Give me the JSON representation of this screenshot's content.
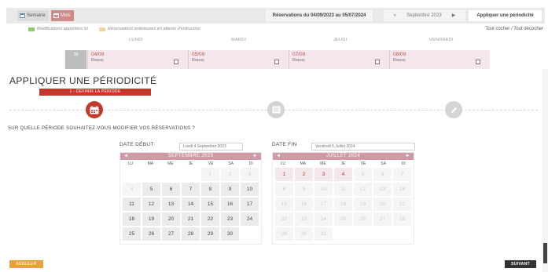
{
  "topbar": {
    "view_semaine": "Semaine",
    "view_mois": "Mois",
    "range": "Réservations du 04/09/2023 au 05/07/2024",
    "month_prev": "«",
    "month_label": "Septembre 2023",
    "month_next": "▶",
    "apply_label": "Appliquer une périodicité"
  },
  "legend": {
    "applied": "Modifications apportées ici",
    "pending": "Réservations antérieures en attente d'instruction",
    "colors": {
      "applied": "#8fca6e",
      "pending": "#f0d79c"
    }
  },
  "select_links": "Tout cocher / Tout décocher",
  "day_headers": [
    "LUNDI",
    "MARDI",
    "JEUDI",
    "VENDREDI"
  ],
  "week_row": {
    "week_num": "36",
    "days": [
      {
        "date": "04/09",
        "label": "Repas"
      },
      {
        "date": "05/09",
        "label": "Repas"
      },
      {
        "date": "07/09",
        "label": "Repas"
      },
      {
        "date": "08/09",
        "label": "Repas"
      }
    ]
  },
  "modal": {
    "title": "APPLIQUER UNE PÉRIODICITÉ",
    "step_label": "1 - DÉFINIR LA PÉRIODE",
    "step_icons": [
      "calendar-icon",
      "list-icon",
      "pencil-icon"
    ],
    "question": "SUR QUELLE PÉRIODE SOUHAITEZ-VOUS MODIFIER VOS RÉSERVATIONS ?",
    "start": {
      "label": "DATE DÉBUT",
      "value": "Lundi 4 Septembre 2023",
      "calendar": {
        "month": "SEPTEMBRE 2023",
        "prev": "◄",
        "next": "►",
        "dow": [
          "LU",
          "MA",
          "ME",
          "JE",
          "VE",
          "SA",
          "DI"
        ],
        "weeks": [
          [
            "",
            "",
            "",
            "",
            "1",
            "2",
            "3"
          ],
          [
            "4",
            "5",
            "6",
            "7",
            "8",
            "9",
            "10"
          ],
          [
            "11",
            "12",
            "13",
            "14",
            "15",
            "16",
            "17"
          ],
          [
            "18",
            "19",
            "20",
            "21",
            "22",
            "23",
            "24"
          ],
          [
            "25",
            "26",
            "27",
            "28",
            "29",
            "30",
            ""
          ]
        ],
        "disabled": [
          "1",
          "2",
          "3",
          "4"
        ]
      }
    },
    "end": {
      "label": "DATE FIN",
      "value": "Vendredi 5 Juillet 2024",
      "calendar": {
        "month": "JUILLET 2024",
        "prev": "◄",
        "next": "►",
        "dow": [
          "LU",
          "MA",
          "ME",
          "JE",
          "VE",
          "SA",
          "DI"
        ],
        "weeks": [
          [
            "1",
            "2",
            "3",
            "4",
            "5",
            "6",
            "7"
          ],
          [
            "8",
            "9",
            "10",
            "11",
            "12",
            "13",
            "14"
          ],
          [
            "15",
            "16",
            "17",
            "18",
            "19",
            "20",
            "21"
          ],
          [
            "22",
            "23",
            "24",
            "25",
            "26",
            "27",
            "28"
          ],
          [
            "29",
            "30",
            "31",
            "",
            "",
            "",
            ""
          ]
        ],
        "highlighted": [
          "1",
          "2",
          "3",
          "4"
        ],
        "disabled": [
          "5",
          "6",
          "7",
          "8",
          "9",
          "10",
          "11",
          "12",
          "13",
          "14",
          "15",
          "16",
          "17",
          "18",
          "19",
          "20",
          "21",
          "22",
          "23",
          "24",
          "25",
          "26",
          "27",
          "28",
          "29",
          "30",
          "31"
        ]
      }
    },
    "cancel_label": "ANNULER",
    "next_label": "SUIVANT"
  },
  "colors": {
    "accent": "#c0392b",
    "cancel": "#e8a23d",
    "dark": "#333333",
    "calendar_header": "#ce9aa5"
  }
}
